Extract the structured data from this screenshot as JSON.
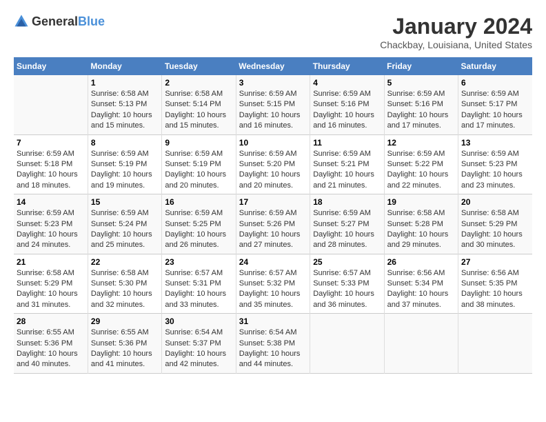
{
  "header": {
    "logo_general": "General",
    "logo_blue": "Blue",
    "title": "January 2024",
    "subtitle": "Chackbay, Louisiana, United States"
  },
  "calendar": {
    "days_of_week": [
      "Sunday",
      "Monday",
      "Tuesday",
      "Wednesday",
      "Thursday",
      "Friday",
      "Saturday"
    ],
    "weeks": [
      [
        {
          "day": "",
          "text": ""
        },
        {
          "day": "1",
          "text": "Sunrise: 6:58 AM\nSunset: 5:13 PM\nDaylight: 10 hours\nand 15 minutes."
        },
        {
          "day": "2",
          "text": "Sunrise: 6:58 AM\nSunset: 5:14 PM\nDaylight: 10 hours\nand 15 minutes."
        },
        {
          "day": "3",
          "text": "Sunrise: 6:59 AM\nSunset: 5:15 PM\nDaylight: 10 hours\nand 16 minutes."
        },
        {
          "day": "4",
          "text": "Sunrise: 6:59 AM\nSunset: 5:16 PM\nDaylight: 10 hours\nand 16 minutes."
        },
        {
          "day": "5",
          "text": "Sunrise: 6:59 AM\nSunset: 5:16 PM\nDaylight: 10 hours\nand 17 minutes."
        },
        {
          "day": "6",
          "text": "Sunrise: 6:59 AM\nSunset: 5:17 PM\nDaylight: 10 hours\nand 17 minutes."
        }
      ],
      [
        {
          "day": "7",
          "text": "Sunrise: 6:59 AM\nSunset: 5:18 PM\nDaylight: 10 hours\nand 18 minutes."
        },
        {
          "day": "8",
          "text": "Sunrise: 6:59 AM\nSunset: 5:19 PM\nDaylight: 10 hours\nand 19 minutes."
        },
        {
          "day": "9",
          "text": "Sunrise: 6:59 AM\nSunset: 5:19 PM\nDaylight: 10 hours\nand 20 minutes."
        },
        {
          "day": "10",
          "text": "Sunrise: 6:59 AM\nSunset: 5:20 PM\nDaylight: 10 hours\nand 20 minutes."
        },
        {
          "day": "11",
          "text": "Sunrise: 6:59 AM\nSunset: 5:21 PM\nDaylight: 10 hours\nand 21 minutes."
        },
        {
          "day": "12",
          "text": "Sunrise: 6:59 AM\nSunset: 5:22 PM\nDaylight: 10 hours\nand 22 minutes."
        },
        {
          "day": "13",
          "text": "Sunrise: 6:59 AM\nSunset: 5:23 PM\nDaylight: 10 hours\nand 23 minutes."
        }
      ],
      [
        {
          "day": "14",
          "text": "Sunrise: 6:59 AM\nSunset: 5:23 PM\nDaylight: 10 hours\nand 24 minutes."
        },
        {
          "day": "15",
          "text": "Sunrise: 6:59 AM\nSunset: 5:24 PM\nDaylight: 10 hours\nand 25 minutes."
        },
        {
          "day": "16",
          "text": "Sunrise: 6:59 AM\nSunset: 5:25 PM\nDaylight: 10 hours\nand 26 minutes."
        },
        {
          "day": "17",
          "text": "Sunrise: 6:59 AM\nSunset: 5:26 PM\nDaylight: 10 hours\nand 27 minutes."
        },
        {
          "day": "18",
          "text": "Sunrise: 6:59 AM\nSunset: 5:27 PM\nDaylight: 10 hours\nand 28 minutes."
        },
        {
          "day": "19",
          "text": "Sunrise: 6:58 AM\nSunset: 5:28 PM\nDaylight: 10 hours\nand 29 minutes."
        },
        {
          "day": "20",
          "text": "Sunrise: 6:58 AM\nSunset: 5:29 PM\nDaylight: 10 hours\nand 30 minutes."
        }
      ],
      [
        {
          "day": "21",
          "text": "Sunrise: 6:58 AM\nSunset: 5:29 PM\nDaylight: 10 hours\nand 31 minutes."
        },
        {
          "day": "22",
          "text": "Sunrise: 6:58 AM\nSunset: 5:30 PM\nDaylight: 10 hours\nand 32 minutes."
        },
        {
          "day": "23",
          "text": "Sunrise: 6:57 AM\nSunset: 5:31 PM\nDaylight: 10 hours\nand 33 minutes."
        },
        {
          "day": "24",
          "text": "Sunrise: 6:57 AM\nSunset: 5:32 PM\nDaylight: 10 hours\nand 35 minutes."
        },
        {
          "day": "25",
          "text": "Sunrise: 6:57 AM\nSunset: 5:33 PM\nDaylight: 10 hours\nand 36 minutes."
        },
        {
          "day": "26",
          "text": "Sunrise: 6:56 AM\nSunset: 5:34 PM\nDaylight: 10 hours\nand 37 minutes."
        },
        {
          "day": "27",
          "text": "Sunrise: 6:56 AM\nSunset: 5:35 PM\nDaylight: 10 hours\nand 38 minutes."
        }
      ],
      [
        {
          "day": "28",
          "text": "Sunrise: 6:55 AM\nSunset: 5:36 PM\nDaylight: 10 hours\nand 40 minutes."
        },
        {
          "day": "29",
          "text": "Sunrise: 6:55 AM\nSunset: 5:36 PM\nDaylight: 10 hours\nand 41 minutes."
        },
        {
          "day": "30",
          "text": "Sunrise: 6:54 AM\nSunset: 5:37 PM\nDaylight: 10 hours\nand 42 minutes."
        },
        {
          "day": "31",
          "text": "Sunrise: 6:54 AM\nSunset: 5:38 PM\nDaylight: 10 hours\nand 44 minutes."
        },
        {
          "day": "",
          "text": ""
        },
        {
          "day": "",
          "text": ""
        },
        {
          "day": "",
          "text": ""
        }
      ]
    ]
  }
}
